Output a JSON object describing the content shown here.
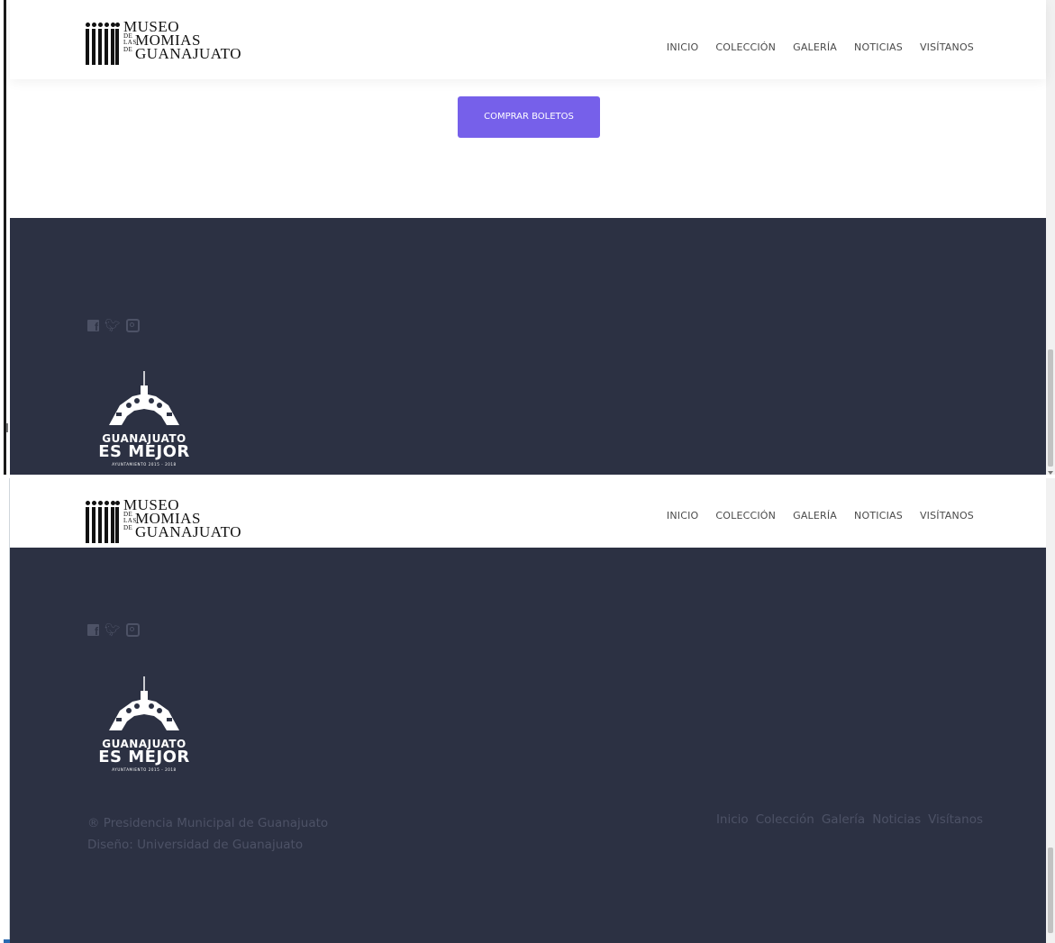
{
  "header": {
    "logo": {
      "line1": "MUSEO",
      "line2_prefix": "DE LAS",
      "line2": "MOMIAS",
      "line3_prefix": "DE",
      "line3": "GUANAJUATO"
    },
    "nav": [
      "INICIO",
      "COLECCIÓN",
      "GALERÍA",
      "NOTICIAS",
      "VISÍTANOS"
    ]
  },
  "cta": {
    "label": "COMPRAR BOLETOS"
  },
  "footer": {
    "social_icons": [
      "facebook-icon",
      "twitter-icon",
      "instagram-icon"
    ],
    "partner_logo": {
      "line1": "GUANAJUATO",
      "line2": "ES MEJOR",
      "line3": "AYUNTAMIENTO 2015 - 2018"
    },
    "copyright": "® Presidencia Municipal de Guanajuato",
    "design_credit": "Diseño: Universidad de Guanajuato",
    "nav": [
      "Inicio",
      "Colección",
      "Galería",
      "Noticias",
      "Visítanos"
    ]
  },
  "colors": {
    "accent": "#7660ea",
    "footer_bg": "#2c3143",
    "footer_text": "#4d5266"
  }
}
